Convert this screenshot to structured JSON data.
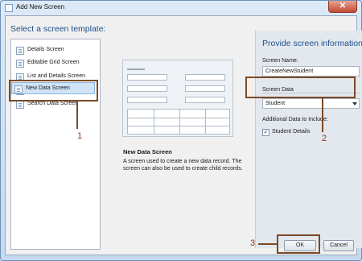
{
  "window": {
    "title": "Add New Screen",
    "close_glyph": "✕"
  },
  "templates": {
    "heading": "Select a screen template:",
    "items": [
      {
        "label": "Details Screen"
      },
      {
        "label": "Editable Grid Screen"
      },
      {
        "label": "List and Details Screen"
      },
      {
        "label": "New Data Screen",
        "selected": true
      },
      {
        "label": "Search Data Screen"
      }
    ]
  },
  "preview": {
    "title": "New Data Screen",
    "description": "A screen used to create a new data record.  The screen can also be used to create child records."
  },
  "info": {
    "heading": "Provide screen information:",
    "screen_name_label": "Screen Name:",
    "screen_name_value": "CreateNewStudent",
    "screen_data_label": "Screen Data",
    "screen_data_value": "Student",
    "additional_label": "Additional Data to Include:",
    "student_details_label": "Student Details",
    "student_details_checked": "✓"
  },
  "buttons": {
    "ok": "OK",
    "cancel": "Cancel"
  },
  "annotations": {
    "one": "1",
    "two": "2",
    "three": "3"
  },
  "colors": {
    "callout": "#7b4a26",
    "heading": "#1e4f8c"
  }
}
